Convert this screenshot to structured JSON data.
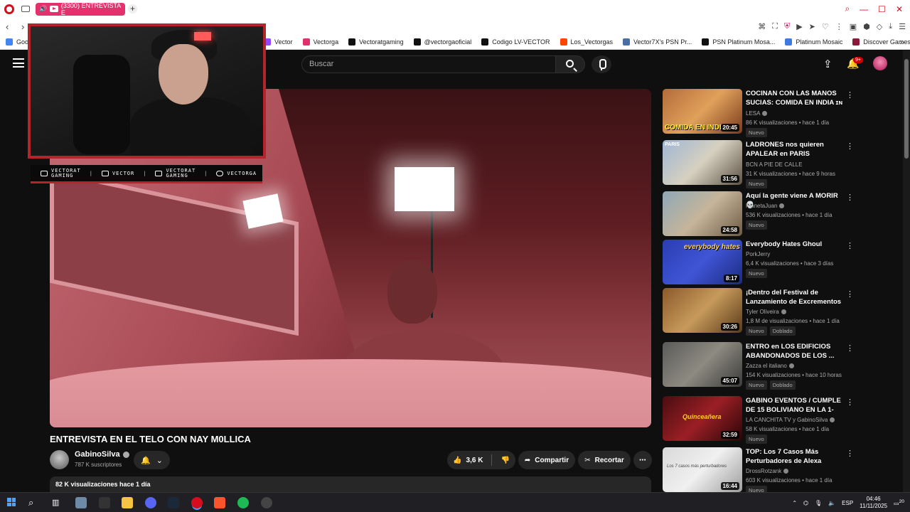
{
  "browser": {
    "tab_title": "(3300) ENTREVISTA E",
    "window_controls": [
      "search",
      "minimize",
      "maximize",
      "close"
    ]
  },
  "bookmarks": [
    {
      "label": "Goog",
      "color": "#4285f4"
    },
    {
      "label": "Vector",
      "color": "#9146ff"
    },
    {
      "label": "Vectorga",
      "color": "#e1306c"
    },
    {
      "label": "Vectoratgaming",
      "color": "#111111"
    },
    {
      "label": "@vectorgaoficial",
      "color": "#111111"
    },
    {
      "label": "Codigo LV-VECTOR",
      "color": "#111111"
    },
    {
      "label": "Los_Vectorgas",
      "color": "#ff4500"
    },
    {
      "label": "Vector7X's PSN Pr...",
      "color": "#4a6fa5"
    },
    {
      "label": "PSN Platinum Mosa...",
      "color": "#111111"
    },
    {
      "label": "Platinum Mosaic",
      "color": "#3d7be0"
    },
    {
      "label": "Discover Games -...",
      "color": "#8b1a3a"
    }
  ],
  "youtube": {
    "search_placeholder": "Buscar",
    "notification_count": "9+",
    "video": {
      "title": "ENTREVISTA EN EL TELO CON NAY M0LLICA",
      "channel": "GabinoSilva",
      "subscribers": "787 K suscriptores",
      "likes": "3,6 K",
      "share_label": "Compartir",
      "clip_label": "Recortar",
      "views_date": "82 K visualizaciones  hace 1 día"
    },
    "overlay": {
      "socials": [
        {
          "line1": "VECTORAT",
          "line2": "GAMING"
        },
        {
          "line1": "VECTOR",
          "line2": ""
        },
        {
          "line1": "VECTORAT",
          "line2": "GAMING"
        },
        {
          "line1": "VECTORGA",
          "line2": ""
        }
      ]
    },
    "recommendations": [
      {
        "title": "COCINAN CON LAS MANOS SUCIAS: COMIDA EN INDIA ɪɴ",
        "channel": "LESA",
        "meta": "86 K visualizaciones • hace 1 día",
        "duration": "20:45",
        "badges": [
          "Nuevo"
        ],
        "thumb_text": "COMIDA EN INDIA"
      },
      {
        "title": "LADRONES nos quieren APALEAR en PARIS",
        "channel": "BCN A PIE DE CALLE",
        "meta": "31 K visualizaciones • hace 9 horas",
        "duration": "31:56",
        "badges": [
          "Nuevo"
        ],
        "thumb_text": "PARIS"
      },
      {
        "title": "Aquí la gente viene A MORIR 💀",
        "channel": "PlanetaJuan",
        "meta": "536 K visualizaciones • hace 1 día",
        "duration": "24:58",
        "badges": [
          "Nuevo"
        ],
        "thumb_text": ""
      },
      {
        "title": "Everybody Hates Ghoul",
        "channel": "PorkJerry",
        "meta": "6,4 K visualizaciones • hace 3 días",
        "duration": "8:17",
        "badges": [
          "Nuevo"
        ],
        "thumb_text": "everybody hates"
      },
      {
        "title": "¡Dentro del Festival de Lanzamiento de Excrementos ...",
        "channel": "Tyler Oliveira",
        "meta": "1,8 M de visualizaciones • hace 1 día",
        "duration": "30:26",
        "badges": [
          "Nuevo",
          "Doblado"
        ],
        "thumb_text": ""
      },
      {
        "title": "ENTRO en LOS EDIFICIOS ABANDONADOS DE LOS ...",
        "channel": "Zazza el italiano",
        "meta": "154 K visualizaciones • hace 10 horas",
        "duration": "45:07",
        "badges": [
          "Nuevo",
          "Doblado"
        ],
        "thumb_text": ""
      },
      {
        "title": "GABINO EVENTOS / CUMPLE DE 15 BOLIVIANO EN LA 1-11-...",
        "channel": "LA CANCHITA TV y GabinoSilva",
        "meta": "58 K visualizaciones • hace 1 día",
        "duration": "32:59",
        "badges": [
          "Nuevo"
        ],
        "thumb_text": "Quinceañera"
      },
      {
        "title": "TOP: Los 7 Casos Más Perturbadores de Alexa",
        "channel": "DrossRotzank",
        "meta": "603 K visualizaciones • hace 1 día",
        "duration": "16:44",
        "badges": [
          "Nuevo"
        ],
        "thumb_text": "Los 7 casos más perturbadores"
      }
    ]
  },
  "taskbar": {
    "language": "ESP",
    "time": "04:46",
    "date": "11/11/2025",
    "notifications": "20"
  }
}
